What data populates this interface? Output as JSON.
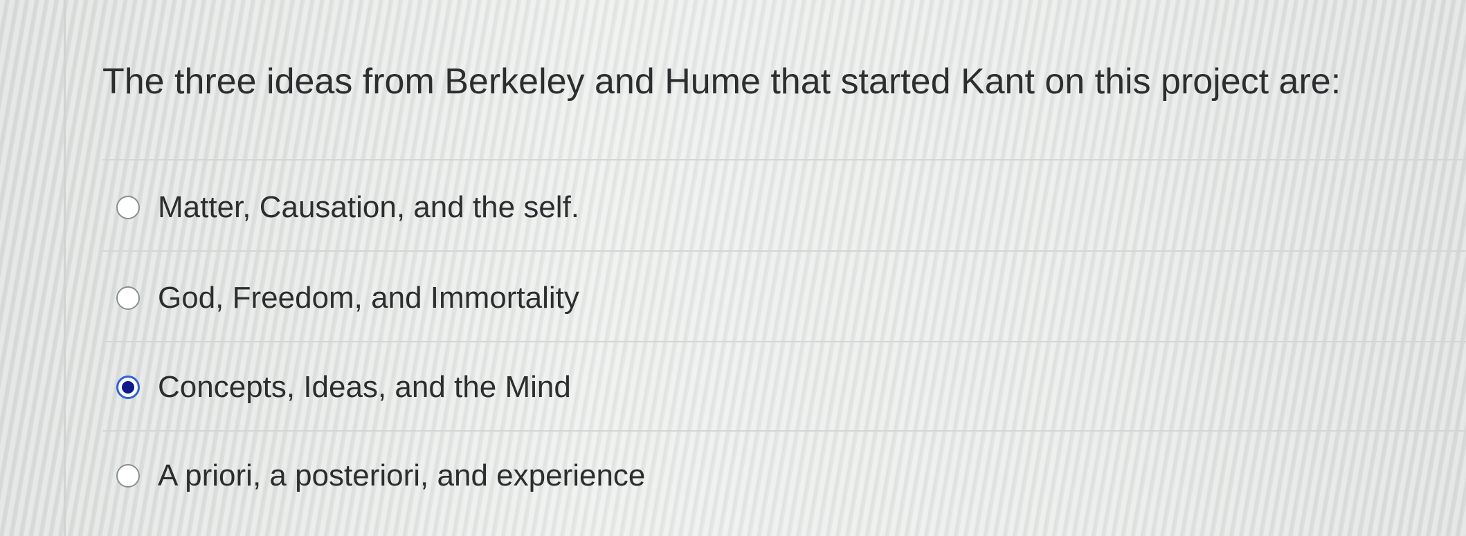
{
  "question": {
    "text": "The three ideas from Berkeley and Hume that started Kant on this project are:"
  },
  "options": [
    {
      "label": "Matter, Causation, and the self.",
      "selected": false
    },
    {
      "label": "God, Freedom, and Immortality",
      "selected": false
    },
    {
      "label": "Concepts, Ideas, and the Mind",
      "selected": true
    },
    {
      "label": "A priori, a posteriori, and experience",
      "selected": false
    }
  ],
  "colors": {
    "text": "#2b2d2f",
    "radio_border": "#8a8e91",
    "radio_selected_ring": "#2c63d6",
    "radio_selected_dot": "#0d1a8a"
  }
}
